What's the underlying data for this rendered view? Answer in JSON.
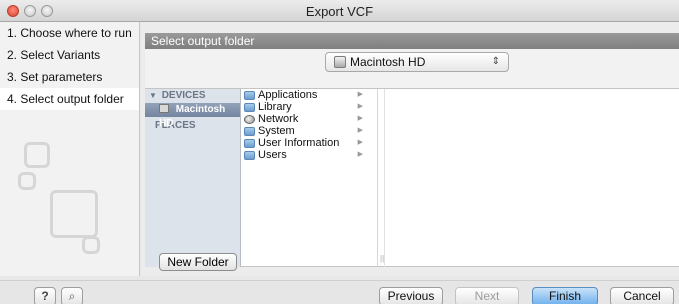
{
  "window": {
    "title": "Export VCF",
    "colors": {
      "close": "#d9432f",
      "header": "#8a8a8a",
      "selected": "#7485a0",
      "primary": "#6fb0ee"
    }
  },
  "steps": [
    {
      "label": "1. Choose where to run"
    },
    {
      "label": "2. Select Variants"
    },
    {
      "label": "3. Set parameters"
    },
    {
      "label": "4. Select output folder"
    }
  ],
  "content": {
    "header": "Select output folder",
    "location": {
      "selected": "Macintosh HD",
      "icon": "hard-drive-icon"
    }
  },
  "sidebar": {
    "devices_label": "DEVICES",
    "device_item": "Macintosh HD",
    "places_label": "PLACES"
  },
  "folders": [
    {
      "name": "Applications",
      "icon": "folder-icon"
    },
    {
      "name": "Library",
      "icon": "folder-icon"
    },
    {
      "name": "Network",
      "icon": "network-globe-icon"
    },
    {
      "name": "System",
      "icon": "folder-icon"
    },
    {
      "name": "User Information",
      "icon": "folder-icon"
    },
    {
      "name": "Users",
      "icon": "folder-icon"
    }
  ],
  "buttons": {
    "new_folder": "New Folder",
    "help": "?",
    "previous": "Previous",
    "next": "Next",
    "finish": "Finish",
    "cancel": "Cancel"
  }
}
